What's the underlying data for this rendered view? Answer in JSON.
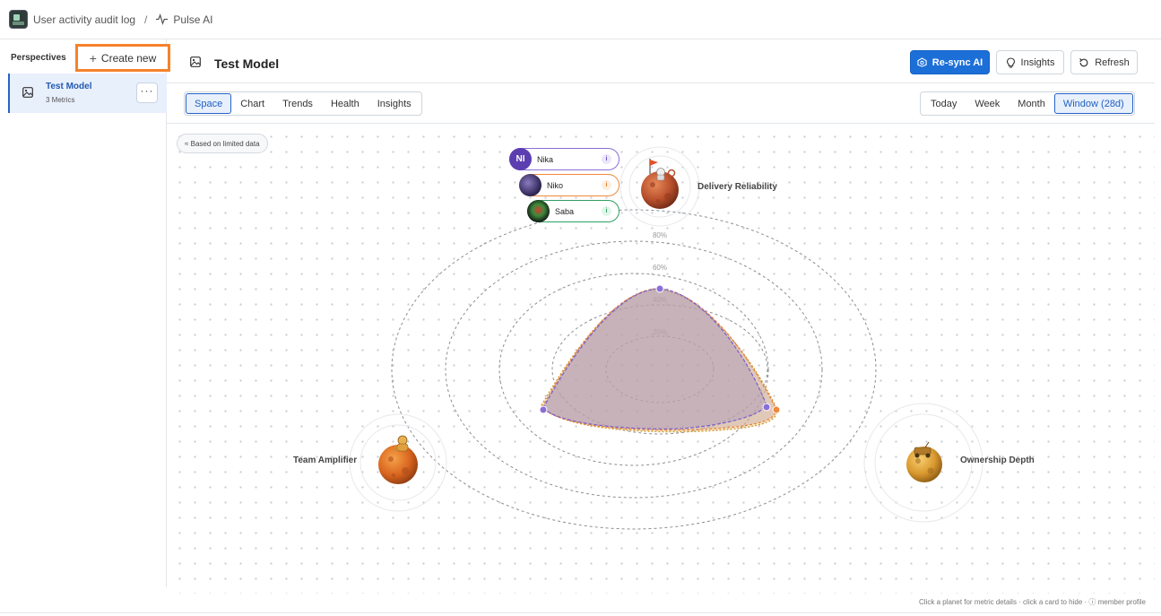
{
  "breadcrumb": {
    "parent": "User activity audit log",
    "separator": "/",
    "current": "Pulse AI"
  },
  "sidebar": {
    "title": "Perspectives",
    "create_label": "Create new",
    "items": [
      {
        "name": "Test Model",
        "subtitle": "3 Metrics",
        "menu": "···"
      }
    ]
  },
  "header": {
    "title": "Test Model",
    "resync_label": "Re-sync AI",
    "insights_label": "Insights",
    "refresh_label": "Refresh"
  },
  "view_tabs": [
    "Space",
    "Chart",
    "Trends",
    "Health",
    "Insights"
  ],
  "active_view": "Space",
  "time_tabs": [
    "Today",
    "Week",
    "Month",
    "Window (28d)"
  ],
  "active_time": "Window (28d)",
  "limited_data_badge": "≈ Based on limited data",
  "rings": [
    "20%",
    "40%",
    "60%",
    "80%"
  ],
  "members": [
    {
      "initials": "NI",
      "name": "Nika",
      "color": "#5b3fb0",
      "info": "i"
    },
    {
      "name": "Niko",
      "color": "#f08a3c",
      "info": "i"
    },
    {
      "name": "Saba",
      "color": "#2e9e63",
      "info": "i"
    }
  ],
  "planets": [
    {
      "label": "Delivery Reliability",
      "icon": "planet-flag-icon"
    },
    {
      "label": "Team Amplifier",
      "icon": "planet-astronaut-icon"
    },
    {
      "label": "Ownership Depth",
      "icon": "planet-rover-icon"
    }
  ],
  "footer_hint": "Click a planet for metric details · click a card to hide · ⓘ member profile",
  "colors": {
    "accent": "#1d6fd8",
    "highlight": "#f5822a"
  }
}
